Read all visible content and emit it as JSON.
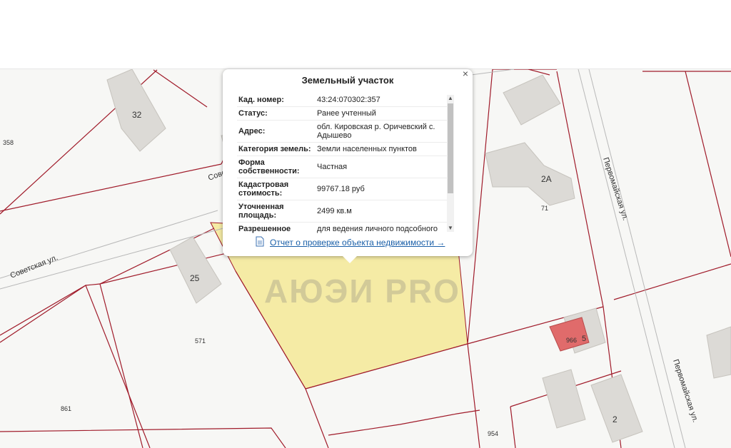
{
  "map": {
    "street_labels": {
      "sovetskaya": "Советская ул.",
      "sovetskaya_top": "Сове",
      "pervomayskaya_top": "Первомайская ул.",
      "pervomayskaya_bottom": "Первомайская ул."
    },
    "building_labels": {
      "b32": "32",
      "b2a": "2А",
      "b25": "25",
      "b2": "2",
      "b966": "966",
      "b5": "5"
    },
    "parcel_labels": {
      "p358": "358",
      "p71": "71",
      "p571": "571",
      "p861": "861",
      "p954": "954"
    },
    "colors": {
      "parcel_border": "#a01b2a",
      "selected_parcel": "#f5eba5",
      "building": "#dcdad6",
      "highlight_building": "#e06b6b"
    }
  },
  "popup": {
    "title": "Земельный участок",
    "close_glyph": "×",
    "rows": [
      {
        "key": "Кад. номер:",
        "value": "43:24:070302:357"
      },
      {
        "key": "Статус:",
        "value": "Ранее учтенный"
      },
      {
        "key": "Адрес:",
        "value": "обл. Кировская р. Оричевский с. Адышево"
      },
      {
        "key": "Категория земель:",
        "value": "Земли населенных пунктов"
      },
      {
        "key": "Форма собственности:",
        "value": "Частная"
      },
      {
        "key": "Кадастровая стоимость:",
        "value": "99767.18 руб"
      },
      {
        "key": "Уточненная площадь:",
        "value": "2499 кв.м"
      },
      {
        "key": "Разрешенное",
        "value": "для ведения личного подсобного"
      }
    ],
    "report_link": "Отчет о проверке объекта недвижимости →",
    "icons": {
      "report": "document-icon",
      "close": "close-icon"
    }
  },
  "watermark": "АЮЭИ PRO"
}
